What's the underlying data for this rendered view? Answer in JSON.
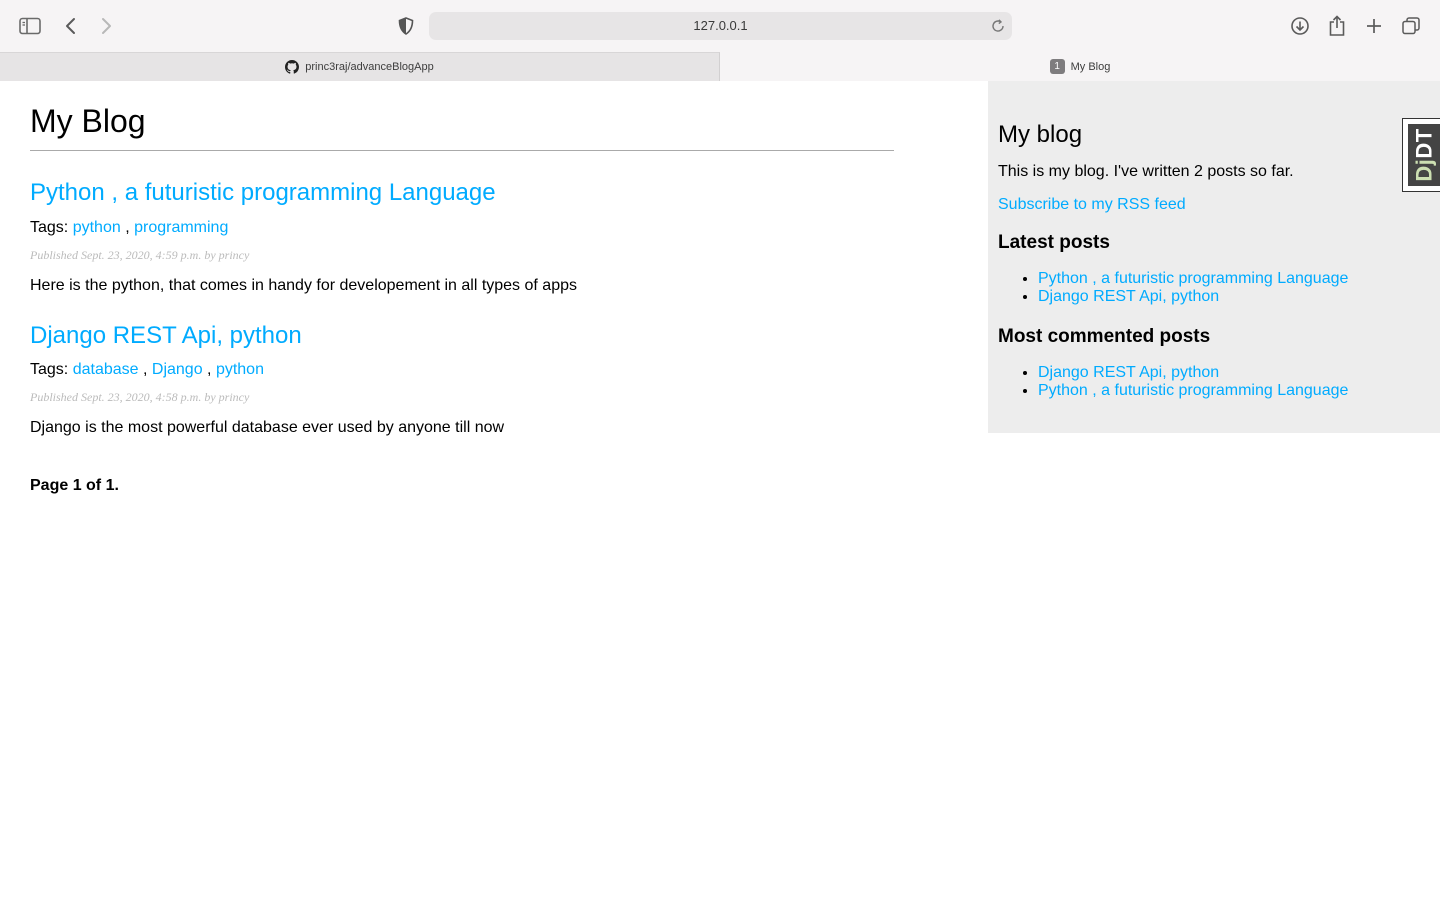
{
  "browser": {
    "url": "127.0.0.1",
    "tabs": [
      {
        "title": "princ3raj/advanceBlogApp",
        "icon": "github-icon"
      },
      {
        "title": "My Blog",
        "badge": "1"
      }
    ]
  },
  "page": {
    "title": "My Blog",
    "posts": [
      {
        "title": "Python , a futuristic programming Language",
        "tags_label": "Tags:",
        "tags": [
          "python",
          "programming"
        ],
        "date_line": "Published Sept. 23, 2020, 4:59 p.m. by princy",
        "body": "Here is the python, that comes in handy for developement in all types of apps"
      },
      {
        "title": "Django REST Api, python",
        "tags_label": "Tags:",
        "tags": [
          "database",
          "Django",
          "python"
        ],
        "date_line": "Published Sept. 23, 2020, 4:58 p.m. by princy",
        "body": "Django is the most powerful database ever used by anyone till now"
      }
    ],
    "pagination": "Page 1 of 1."
  },
  "sidebar": {
    "title": "My blog",
    "intro": "This is my blog. I've written 2 posts so far.",
    "rss_link": "Subscribe to my RSS feed",
    "latest_heading": "Latest posts",
    "latest": [
      "Python , a futuristic programming Language",
      "Django REST Api, python"
    ],
    "most_commented_heading": "Most commented posts",
    "most_commented": [
      "Django REST Api, python",
      "Python , a futuristic programming Language"
    ]
  },
  "debug_toolbar": {
    "dj": "Dj",
    "dt": "DT"
  },
  "colors": {
    "link": "#00abff",
    "sidebar_bg": "#ededed"
  }
}
